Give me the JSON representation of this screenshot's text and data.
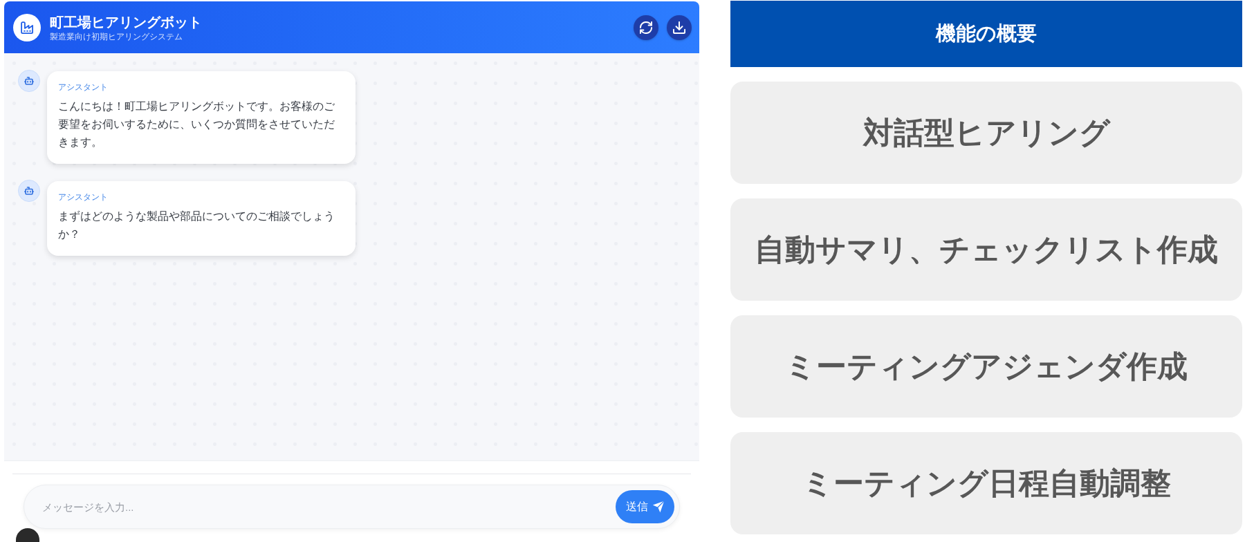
{
  "app_header": {
    "title": "町工場ヒアリングボット",
    "subtitle": "製造業向け初期ヒアリングシステム"
  },
  "messages": [
    {
      "sender": "アシスタント",
      "text": "こんにちは！町工場ヒアリングボットです。お客様のご要望をお伺いするために、いくつか質問をさせていただきます。"
    },
    {
      "sender": "アシスタント",
      "text": "まずはどのような製品や部品についてのご相談でしょうか？"
    }
  ],
  "composer": {
    "placeholder": "メッセージを入力...",
    "send_label": "送信"
  },
  "features": {
    "title": "機能の概要",
    "items": [
      "対話型ヒアリング",
      "自動サマリ、チェックリスト作成",
      "ミーティングアジェンダ作成",
      "ミーティング日程自動調整"
    ]
  }
}
